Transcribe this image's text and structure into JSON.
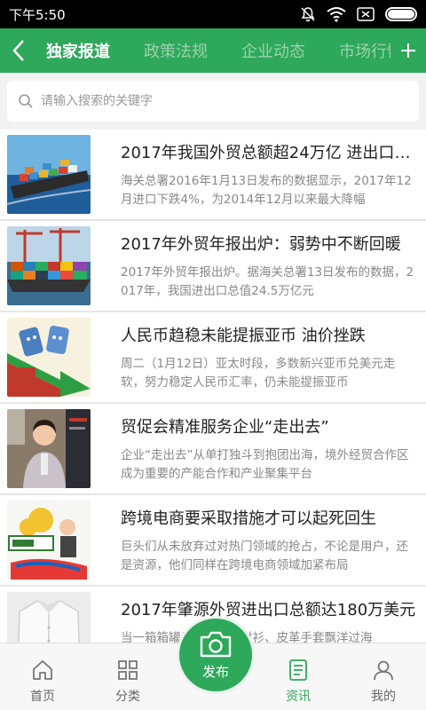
{
  "status_bar": {
    "time": "下午5:50"
  },
  "nav": {
    "tabs": [
      "独家报道",
      "政策法规",
      "企业动态",
      "市场行情"
    ]
  },
  "search": {
    "placeholder": "请输入搜索的关键字"
  },
  "news": [
    {
      "title": "2017年我国外贸总额超24万亿 进出口双双回升",
      "summary": "海关总署2016年1月13日发布的数据显示，2017年12月进口下跌4%，为2014年12月以来最大降幅",
      "thumb": "cargo-ship-thumb"
    },
    {
      "title": "2017年外贸年报出炉：弱势中不断回暖",
      "summary": "2017年外贸年报出炉。据海关总署13日发布的数据，2017年，我国进出口总值24.5万亿元",
      "thumb": "container-port-thumb"
    },
    {
      "title": "人民币趋稳未能提振亚币 油价挫跌",
      "summary": "周二（1月12日）亚太时段，多数新兴亚币兑美元走软，努力稳定人民币汇率，仍未能提振亚币",
      "thumb": "oil-barrels-thumb"
    },
    {
      "title": "贸促会精准服务企业“走出去”",
      "summary": "企业“走出去”从单打独斗到抱团出海，境外经贸合作区成为重要的产能合作和产业聚集平台",
      "thumb": "woman-expo-thumb"
    },
    {
      "title": "跨境电商要采取措施才可以起死回生",
      "summary": "巨头们从未放弃过对热门领域的抢占，不论是用户，还是资源，他们同样在跨境电商领域加紧布局",
      "thumb": "ecommerce-cartoon-thumb"
    },
    {
      "title": "2017年肇源外贸进出口总额达180万美元",
      "summary": "当一箱箱罐头、一件件衬衫、皮革手套飘洋过海",
      "thumb": "white-shirt-thumb"
    }
  ],
  "tab_bar": {
    "items": [
      {
        "label": "首页",
        "icon": "home-icon"
      },
      {
        "label": "分类",
        "icon": "grid-icon"
      },
      {
        "label": "资讯",
        "icon": "news-icon"
      },
      {
        "label": "我的",
        "icon": "user-icon"
      }
    ],
    "publish_label": "发布",
    "active_label": "资讯"
  },
  "colors": {
    "accent": "#2ea85a"
  }
}
